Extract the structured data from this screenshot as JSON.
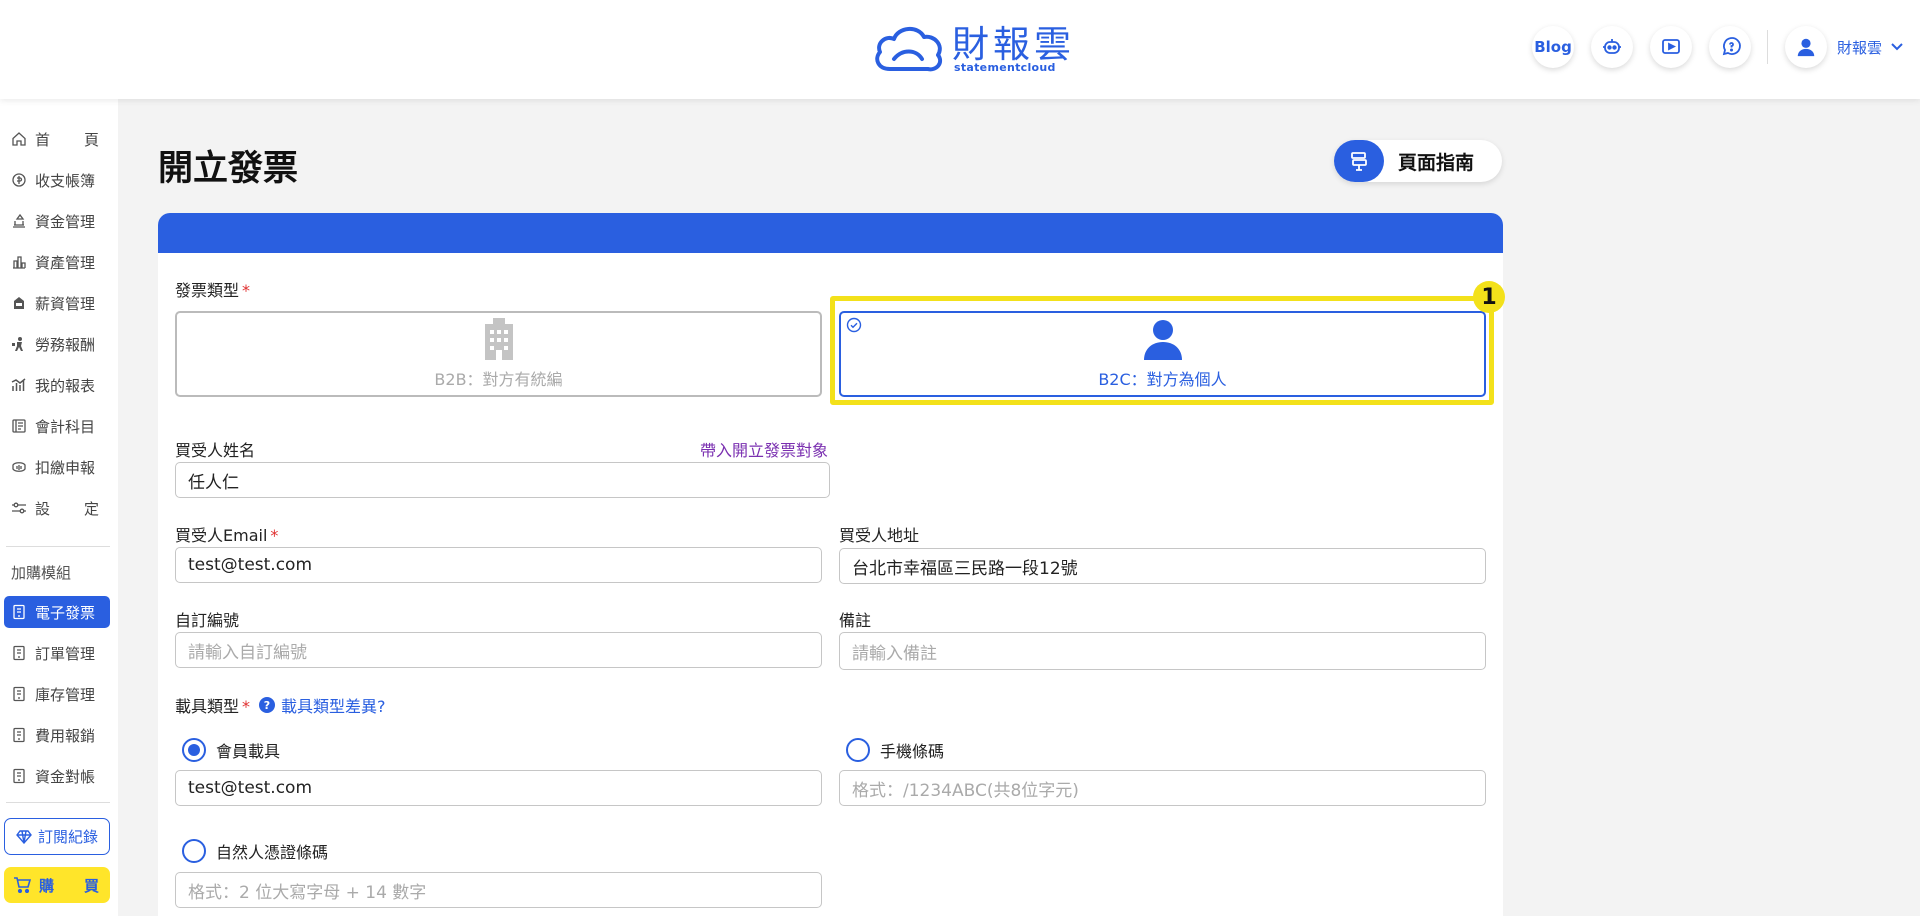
{
  "header": {
    "logo_zh": "財報雲",
    "logo_en": "statementcloud",
    "blog_label": "Blog",
    "icons": [
      "robot-icon",
      "video-icon",
      "help-chat-icon"
    ],
    "user_name": "財報雲"
  },
  "sidebar": {
    "items": [
      {
        "label": "首頁",
        "chars": [
          "首",
          "頁"
        ],
        "icon": "home-icon"
      },
      {
        "label": "收支帳簿",
        "icon": "coin-icon"
      },
      {
        "label": "資金管理",
        "icon": "bank-icon"
      },
      {
        "label": "資產管理",
        "icon": "building-icon"
      },
      {
        "label": "薪資管理",
        "icon": "payroll-icon"
      },
      {
        "label": "勞務報酬",
        "icon": "worker-icon"
      },
      {
        "label": "我的報表",
        "icon": "chart-icon"
      },
      {
        "label": "會計科目",
        "icon": "ledger-icon"
      },
      {
        "label": "扣繳申報",
        "icon": "tax-icon"
      },
      {
        "label": "設定",
        "chars": [
          "設",
          "定"
        ],
        "icon": "settings-icon"
      }
    ],
    "group_title": "加購模組",
    "modules": [
      {
        "label": "電子發票",
        "active": true
      },
      {
        "label": "訂單管理"
      },
      {
        "label": "庫存管理"
      },
      {
        "label": "費用報銷"
      },
      {
        "label": "資金對帳"
      }
    ],
    "subscription_label": "訂閱紀錄",
    "buy_chars": [
      "購",
      "買"
    ]
  },
  "page": {
    "title": "開立發票",
    "guide_label": "頁面指南"
  },
  "form": {
    "invoice_type_label": "發票類型",
    "b2b_label": "B2B：對方有統編",
    "b2c_label": "B2C：對方為個人",
    "selected_type": "B2C",
    "highlight_number": "1",
    "buyer_name_label": "買受人姓名",
    "import_link": "帶入開立發票對象",
    "buyer_name_value": "任人仁",
    "buyer_email_label": "買受人Email",
    "buyer_email_value": "test@test.com",
    "buyer_address_label": "買受人地址",
    "buyer_address_value": "台北市幸福區三民路一段12號",
    "custom_no_label": "自訂編號",
    "custom_no_placeholder": "請輸入自訂編號",
    "note_label": "備註",
    "note_placeholder": "請輸入備註",
    "carrier_type_label": "載具類型",
    "carrier_help_link": "載具類型差異?",
    "carrier_help_icon": "?",
    "carrier_options": [
      {
        "label": "會員載具",
        "selected": true,
        "value": "test@test.com",
        "placeholder": ""
      },
      {
        "label": "手機條碼",
        "selected": false,
        "value": "",
        "placeholder": "格式：/1234ABC(共8位字元)"
      },
      {
        "label": "自然人憑證條碼",
        "selected": false,
        "value": "",
        "placeholder": "格式：2 位大寫字母 + 14 數字"
      }
    ]
  },
  "colors": {
    "primary": "#2a5fe0",
    "highlight": "#f3e11a",
    "buy": "#ffe52a",
    "link": "#7a2fb0"
  }
}
